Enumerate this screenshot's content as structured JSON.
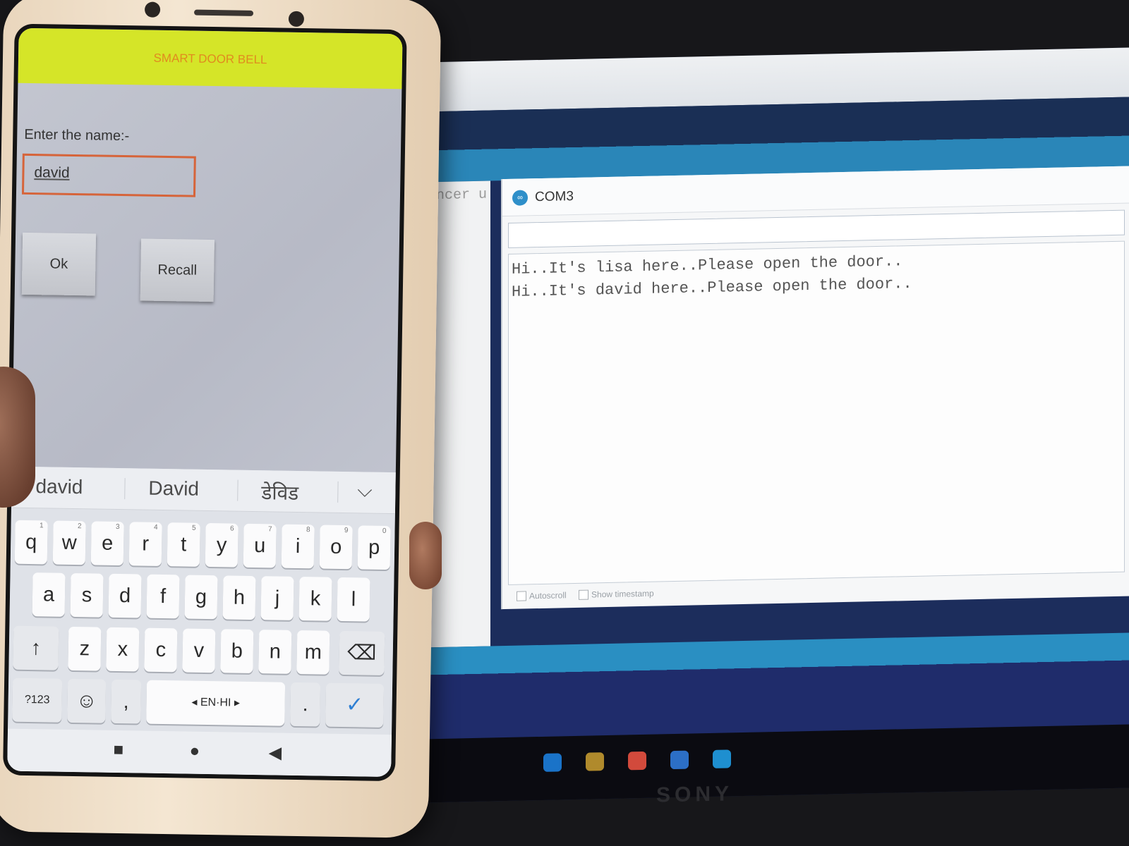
{
  "laptop": {
    "editor_fragment": "incer u",
    "brand": "SONY",
    "serial_monitor": {
      "port": "COM3",
      "logo_glyph": "∞",
      "send_value": "",
      "lines": [
        "Hi..It's lisa here..Please open the door..",
        "Hi..It's david here..Please open the door.."
      ],
      "autoscroll_label": "Autoscroll",
      "timestamp_label": "Show timestamp"
    }
  },
  "phone": {
    "app": {
      "title": "SMART DOOR BELL",
      "prompt": "Enter the name:-",
      "name_value": "david",
      "ok_label": "Ok",
      "recall_label": "Recall"
    },
    "keyboard": {
      "suggestions": [
        "david",
        "David",
        "डेविड"
      ],
      "expand_glyph": "⌵",
      "row1": [
        "q",
        "w",
        "e",
        "r",
        "t",
        "y",
        "u",
        "i",
        "o",
        "p"
      ],
      "row1_hints": [
        "1",
        "2",
        "3",
        "4",
        "5",
        "6",
        "7",
        "8",
        "9",
        "0"
      ],
      "row2": [
        "a",
        "s",
        "d",
        "f",
        "g",
        "h",
        "j",
        "k",
        "l"
      ],
      "row3": [
        "z",
        "x",
        "c",
        "v",
        "b",
        "n",
        "m"
      ],
      "shift_glyph": "↑",
      "backspace_glyph": "⌫",
      "symbols_label": "?123",
      "emoji_glyph": "☺",
      "comma": ",",
      "space_label": "◂ EN·HI ▸",
      "period": ".",
      "enter_glyph": "✓"
    },
    "nav": {
      "recents": "■",
      "home": "●",
      "back": "◀"
    }
  }
}
